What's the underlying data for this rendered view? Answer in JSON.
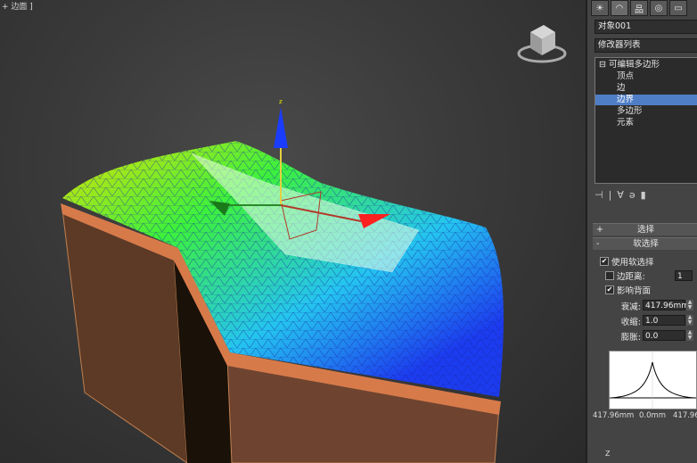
{
  "viewport": {
    "label": "+ 边面 ]"
  },
  "panel": {
    "tabs": [
      "☀",
      "◠",
      "品",
      "◎",
      "▭"
    ],
    "object_name": "对象001",
    "modifier_list_label": "修改器列表",
    "stack": {
      "root": "可编辑多边形",
      "items": [
        "顶点",
        "边",
        "边界",
        "多边形",
        "元素"
      ],
      "selected_index": 2
    },
    "tools": [
      "⊣",
      "|",
      "∀",
      "ə",
      "▮"
    ],
    "rollout_selection": "选择",
    "rollout_soft_selection": "软选择",
    "use_soft_selection": {
      "label": "使用软选择",
      "checked": true
    },
    "edge_distance": {
      "label": "边距离:",
      "checked": false,
      "value": "1"
    },
    "affect_backfacing": {
      "label": "影响背面",
      "checked": true
    },
    "falloff": {
      "label": "衰减:",
      "value": "417.96mm"
    },
    "pinch": {
      "label": "收缩:",
      "value": "1.0"
    },
    "bubble": {
      "label": "膨胀:",
      "value": "0.0"
    },
    "curve_labels": {
      "left": "417.96mm",
      "center": "0.0mm",
      "right": "417.96"
    },
    "bottom_axis_label": "Z"
  },
  "colors": {
    "selection": "#4f7ec6",
    "mesh_blue": "#1a3cff",
    "mesh_green": "#3cff3c",
    "mesh_yellow": "#f0f000",
    "box_brown": "#7a4a30"
  }
}
